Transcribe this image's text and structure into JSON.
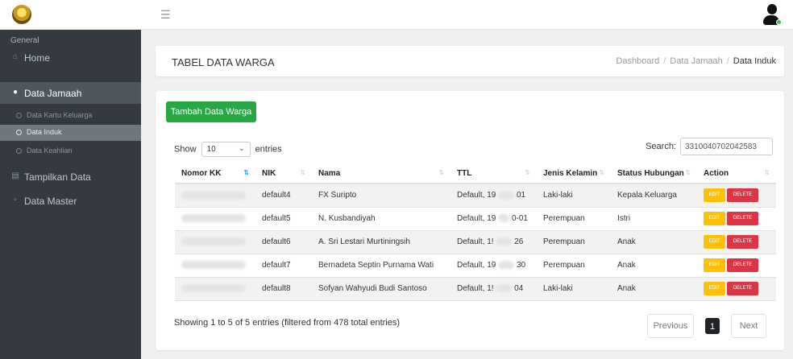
{
  "sidebar": {
    "header": "General",
    "items": [
      {
        "label": "Home",
        "icon": "home-icon"
      },
      {
        "label": "Data Jamaah",
        "icon": "users-icon"
      },
      {
        "label": "Tampilkan Data",
        "icon": "list-icon"
      },
      {
        "label": "Data Master",
        "icon": "database-icon"
      }
    ],
    "subitems": [
      {
        "label": "Data Kartu Keluarga"
      },
      {
        "label": "Data Induk"
      },
      {
        "label": "Data Keahlian"
      }
    ]
  },
  "header": {
    "title": "TABEL DATA WARGA",
    "breadcrumb": [
      "Dashboard",
      "Data Jamaah",
      "Data Induk"
    ],
    "separator": "/"
  },
  "card": {
    "add_label": "Tambah Data Warga",
    "show_label": "Show",
    "entries_value": "10",
    "entries_label": "entries",
    "search_label": "Search:",
    "search_value": "3310040702042583"
  },
  "table": {
    "columns": [
      "Nomor KK",
      "NIK",
      "Nama",
      "TTL",
      "Jenis Kelamin",
      "Status Hubungan",
      "Action"
    ],
    "rows": [
      {
        "nik": "default4",
        "nama": "FX Suripto",
        "ttl_a": "Default, 19",
        "ttl_b": "01",
        "jk": "Laki-laki",
        "status": "Kepala Keluarga"
      },
      {
        "nik": "default5",
        "nama": "N. Kusbandiyah",
        "ttl_a": "Default, 19",
        "ttl_b": "0-01",
        "jk": "Perempuan",
        "status": "Istri"
      },
      {
        "nik": "default6",
        "nama": "A. Sri Lestari Murtiningsih",
        "ttl_a": "Default, 1!",
        "ttl_b": "26",
        "jk": "Perempuan",
        "status": "Anak"
      },
      {
        "nik": "default7",
        "nama": "Bernadeta Septin Purnama Wati",
        "ttl_a": "Default, 19",
        "ttl_b": "30",
        "jk": "Perempuan",
        "status": "Anak"
      },
      {
        "nik": "default8",
        "nama": "Sofyan Wahyudi Budi Santoso",
        "ttl_a": "Default, 1!",
        "ttl_b": "04",
        "jk": "Laki-laki",
        "status": "Anak"
      }
    ],
    "edit_label": "EDIT",
    "delete_label": "DELETE"
  },
  "footer": {
    "info": "Showing 1 to 5 of 5 entries (filtered from 478 total entries)",
    "prev": "Previous",
    "page": "1",
    "next": "Next"
  },
  "colors": {
    "sidebar_bg": "#343a40",
    "primary_green": "#28a745",
    "edit_yellow": "#ffc107",
    "delete_red": "#dc3545"
  }
}
